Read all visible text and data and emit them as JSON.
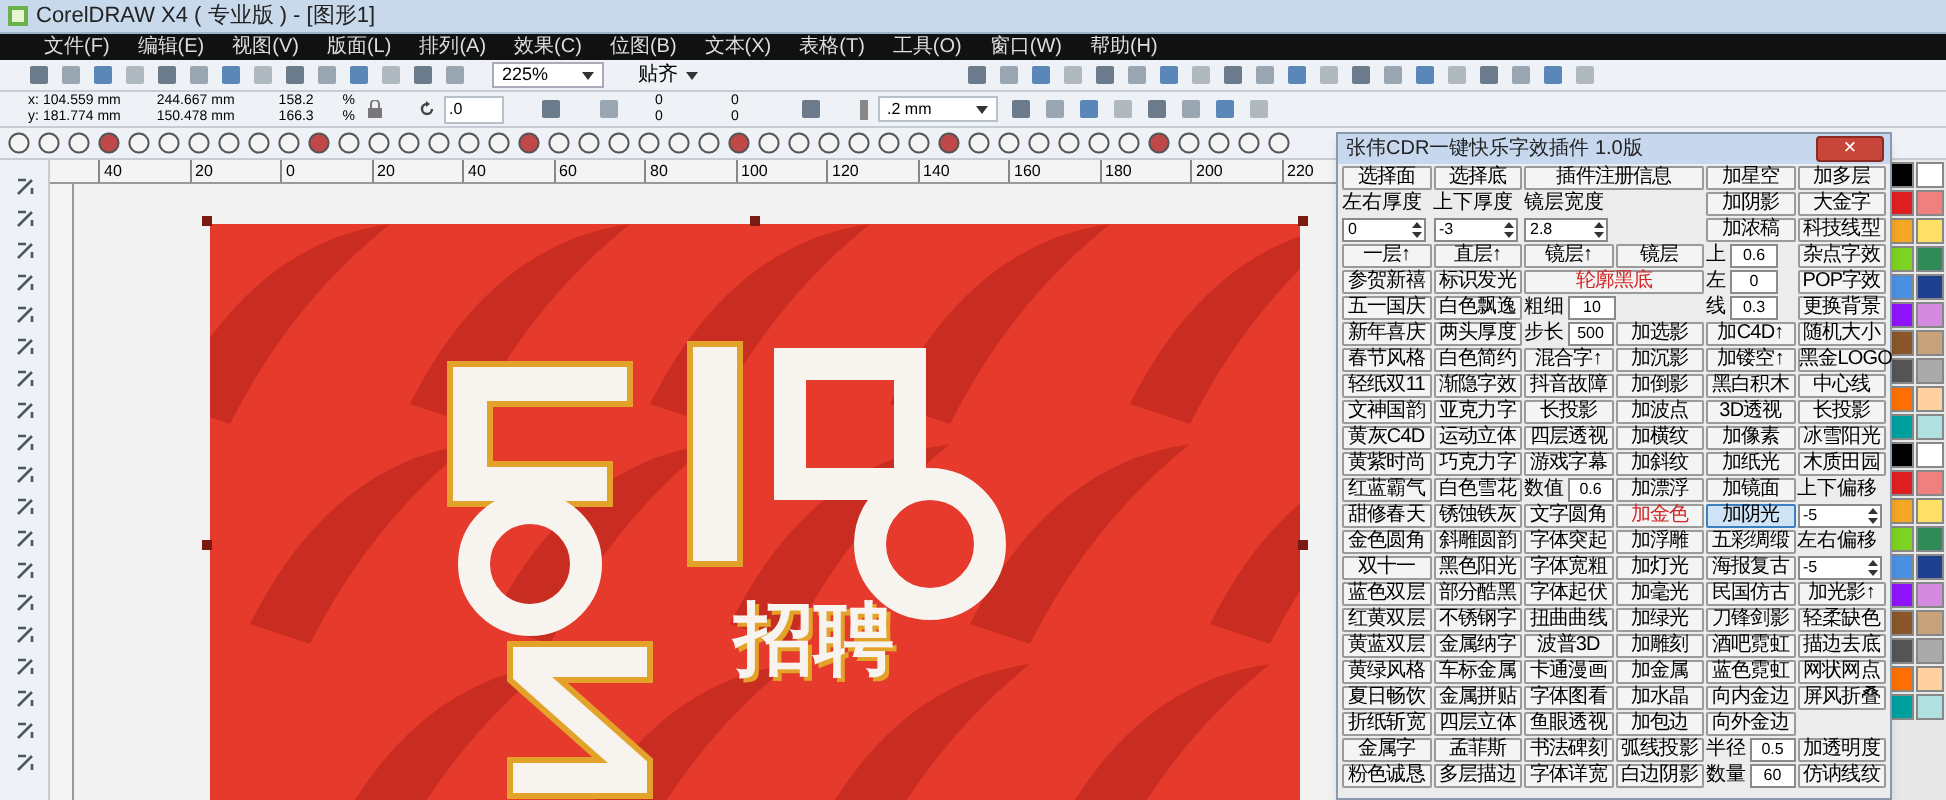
{
  "window": {
    "title": "CorelDRAW X4 ( 专业版 ) - [图形1]"
  },
  "menu": [
    "文件(F)",
    "编辑(E)",
    "视图(V)",
    "版面(L)",
    "排列(A)",
    "效果(C)",
    "位图(B)",
    "文本(X)",
    "表格(T)",
    "工具(O)",
    "窗口(W)",
    "帮助(H)"
  ],
  "toolbar": {
    "zoom": "225%",
    "snap": "贴齐"
  },
  "property_bar": {
    "x_label": "x:",
    "x": "104.559 mm",
    "y_label": "y:",
    "y": "181.774 mm",
    "width": "244.667 mm",
    "height": "150.478 mm",
    "scale": [
      {
        "value": "158.2",
        "unit": "%"
      },
      {
        "value": "166.3",
        "unit": "%"
      }
    ],
    "rotation": ".0",
    "offsets": [
      "0",
      "0",
      "0",
      "0"
    ],
    "outline": ".2 mm"
  },
  "ruler": {
    "top_labels": [
      "40",
      "20",
      "0",
      "20",
      "40",
      "60",
      "80",
      "100",
      "120",
      "140",
      "160",
      "180",
      "200",
      "220"
    ]
  },
  "poster": {
    "caption": "招聘"
  },
  "plugin": {
    "title": "张伟CDR一键快乐字效插件 1.0版",
    "close": "×",
    "rows": [
      [
        {
          "kind": "button",
          "text": "选择面"
        },
        {
          "kind": "button",
          "text": "选择底"
        },
        {
          "kind": "wide_button",
          "text": "插件注册信息"
        },
        {
          "kind": "button",
          "text": "加星空"
        },
        {
          "kind": "button",
          "text": "加多层"
        }
      ],
      [
        {
          "kind": "label",
          "text": "左右厚度"
        },
        {
          "kind": "label",
          "text": "上下厚度"
        },
        {
          "kind": "wide_label",
          "text": "镜层宽度"
        },
        {
          "kind": "button",
          "text": "加阴影"
        },
        {
          "kind": "button",
          "text": "大金字"
        }
      ],
      [
        {
          "kind": "spin",
          "text": "0"
        },
        {
          "kind": "spin",
          "text": "-3"
        },
        {
          "kind": "wide_spin",
          "text": "2.8"
        },
        {
          "kind": "button",
          "text": "加浓稿"
        },
        {
          "kind": "button",
          "text": "科技线型"
        }
      ],
      [
        {
          "kind": "button",
          "text": "一层↑"
        },
        {
          "kind": "button",
          "text": "直层↑"
        },
        {
          "kind": "button",
          "text": "镜层↑"
        },
        {
          "kind": "button",
          "text": "镜层"
        },
        {
          "kind": "field",
          "label": "上",
          "text": "0.6"
        },
        {
          "kind": "button",
          "text": "杂点字效"
        }
      ],
      [
        {
          "kind": "button",
          "text": "参贺新禧"
        },
        {
          "kind": "button",
          "text": "标识发光"
        },
        {
          "kind": "wide_button",
          "text": "轮廓黑底",
          "color": "#d02828"
        },
        {
          "kind": "field",
          "label": "左",
          "text": "0"
        },
        {
          "kind": "button",
          "text": "POP字效"
        }
      ],
      [
        {
          "kind": "button",
          "text": "五一国庆"
        },
        {
          "kind": "button",
          "text": "白色飘逸"
        },
        {
          "kind": "wide_field",
          "label": "粗细",
          "text": "10"
        },
        {
          "kind": "field",
          "label": "线",
          "text": "0.3"
        },
        {
          "kind": "button",
          "text": "更换背景"
        }
      ],
      [
        {
          "kind": "button",
          "text": "新年喜庆"
        },
        {
          "kind": "button",
          "text": "两头厚度"
        },
        {
          "kind": "field",
          "label": "步长",
          "text": "500"
        },
        {
          "kind": "button",
          "text": "加选影"
        },
        {
          "kind": "button",
          "text": "加C4D↑"
        },
        {
          "kind": "button",
          "text": "随机大小"
        }
      ],
      [
        {
          "kind": "button",
          "text": "春节风格"
        },
        {
          "kind": "button",
          "text": "白色简约"
        },
        {
          "kind": "button",
          "text": "混合字↑"
        },
        {
          "kind": "button",
          "text": "加沉影"
        },
        {
          "kind": "button",
          "text": "加镂空↑"
        },
        {
          "kind": "button",
          "text": "黑金LOGO"
        }
      ],
      [
        {
          "kind": "button",
          "text": "轻纸双11"
        },
        {
          "kind": "button",
          "text": "渐隐字效"
        },
        {
          "kind": "button",
          "text": "抖音故障"
        },
        {
          "kind": "button",
          "text": "加倒影"
        },
        {
          "kind": "button",
          "text": "黑白积木"
        },
        {
          "kind": "button",
          "text": "中心线"
        }
      ],
      [
        {
          "kind": "button",
          "text": "文神国韵"
        },
        {
          "kind": "button",
          "text": "亚克力字"
        },
        {
          "kind": "button",
          "text": "长投影"
        },
        {
          "kind": "button",
          "text": "加波点"
        },
        {
          "kind": "button",
          "text": "3D透视"
        },
        {
          "kind": "button",
          "text": "长投影"
        }
      ],
      [
        {
          "kind": "button",
          "text": "黄灰C4D"
        },
        {
          "kind": "button",
          "text": "运动立体"
        },
        {
          "kind": "button",
          "text": "四层透视"
        },
        {
          "kind": "button",
          "text": "加横纹"
        },
        {
          "kind": "button",
          "text": "加像素"
        },
        {
          "kind": "button",
          "text": "冰雪阳光"
        }
      ],
      [
        {
          "kind": "button",
          "text": "黄紫时尚"
        },
        {
          "kind": "button",
          "text": "巧克力字"
        },
        {
          "kind": "button",
          "text": "游戏字幕"
        },
        {
          "kind": "button",
          "text": "加斜纹"
        },
        {
          "kind": "button",
          "text": "加纸光"
        },
        {
          "kind": "button",
          "text": "木质田园"
        }
      ],
      [
        {
          "kind": "button",
          "text": "红蓝霸气"
        },
        {
          "kind": "button",
          "text": "白色雪花"
        },
        {
          "kind": "field",
          "label": "数值",
          "text": "0.6"
        },
        {
          "kind": "button",
          "text": "加漂浮"
        },
        {
          "kind": "button",
          "text": "加镜面"
        },
        {
          "kind": "label",
          "text": "上下偏移"
        }
      ],
      [
        {
          "kind": "button",
          "text": "甜修春天"
        },
        {
          "kind": "button",
          "text": "锈蚀铁灰"
        },
        {
          "kind": "button",
          "text": "文字圆角"
        },
        {
          "kind": "button",
          "text": "加金色",
          "color": "#d02828"
        },
        {
          "kind": "button",
          "text": "加阴光",
          "pressed": true
        },
        {
          "kind": "spin",
          "text": "-5"
        }
      ],
      [
        {
          "kind": "button",
          "text": "金色圆角"
        },
        {
          "kind": "button",
          "text": "斜雕圆韵"
        },
        {
          "kind": "button",
          "text": "字体突起"
        },
        {
          "kind": "button",
          "text": "加浮雕"
        },
        {
          "kind": "button",
          "text": "五彩绸缎"
        },
        {
          "kind": "label",
          "text": "左右偏移"
        }
      ],
      [
        {
          "kind": "button",
          "text": "双十一"
        },
        {
          "kind": "button",
          "text": "黑色阳光"
        },
        {
          "kind": "button",
          "text": "字体宽粗"
        },
        {
          "kind": "button",
          "text": "加灯光"
        },
        {
          "kind": "button",
          "text": "海报复古"
        },
        {
          "kind": "spin",
          "text": "-5"
        }
      ],
      [
        {
          "kind": "button",
          "text": "蓝色双层"
        },
        {
          "kind": "button",
          "text": "部分酷黑"
        },
        {
          "kind": "button",
          "text": "字体起伏"
        },
        {
          "kind": "button",
          "text": "加毫光"
        },
        {
          "kind": "button",
          "text": "民国仿古"
        },
        {
          "kind": "button",
          "text": "加光影↑"
        }
      ],
      [
        {
          "kind": "button",
          "text": "红黄双层"
        },
        {
          "kind": "button",
          "text": "不锈钢字"
        },
        {
          "kind": "button",
          "text": "扭曲曲线"
        },
        {
          "kind": "button",
          "text": "加绿光"
        },
        {
          "kind": "button",
          "text": "刀锋剑影"
        },
        {
          "kind": "button",
          "text": "轻柔缺色"
        }
      ],
      [
        {
          "kind": "button",
          "text": "黄蓝双层"
        },
        {
          "kind": "button",
          "text": "金属纳字"
        },
        {
          "kind": "button",
          "text": "波普3D"
        },
        {
          "kind": "button",
          "text": "加雕刻"
        },
        {
          "kind": "button",
          "text": "酒吧霓虹"
        },
        {
          "kind": "button",
          "text": "描边去底"
        }
      ],
      [
        {
          "kind": "button",
          "text": "黄绿风格"
        },
        {
          "kind": "button",
          "text": "车标金属"
        },
        {
          "kind": "button",
          "text": "卡通漫画"
        },
        {
          "kind": "button",
          "text": "加金属"
        },
        {
          "kind": "button",
          "text": "蓝色霓虹"
        },
        {
          "kind": "button",
          "text": "网状网点"
        }
      ],
      [
        {
          "kind": "button",
          "text": "夏日畅饮"
        },
        {
          "kind": "button",
          "text": "金属拼贴"
        },
        {
          "kind": "button",
          "text": "字体图看"
        },
        {
          "kind": "button",
          "text": "加水晶"
        },
        {
          "kind": "button",
          "text": "向内金边"
        },
        {
          "kind": "button",
          "text": "屏风折叠"
        }
      ],
      [
        {
          "kind": "button",
          "text": "折纸斩宽"
        },
        {
          "kind": "button",
          "text": "四层立体"
        },
        {
          "kind": "button",
          "text": "鱼眼透视"
        },
        {
          "kind": "button",
          "text": "加包边"
        },
        {
          "kind": "button",
          "text": "向外金边"
        }
      ],
      [
        {
          "kind": "button",
          "text": "金属字"
        },
        {
          "kind": "button",
          "text": "孟菲斯"
        },
        {
          "kind": "button",
          "text": "书法碑刻"
        },
        {
          "kind": "button",
          "text": "弧线投影"
        },
        {
          "kind": "field",
          "label": "半径",
          "text": "0.5"
        },
        {
          "kind": "button",
          "text": "加透明度"
        }
      ],
      [
        {
          "kind": "button",
          "text": "粉色诚恳"
        },
        {
          "kind": "button",
          "text": "多层描边"
        },
        {
          "kind": "button",
          "text": "字体详宽"
        },
        {
          "kind": "button",
          "text": "白边阴影"
        },
        {
          "kind": "field",
          "label": "数量",
          "text": "60"
        },
        {
          "kind": "button",
          "text": "仿讷线纹"
        }
      ]
    ]
  }
}
